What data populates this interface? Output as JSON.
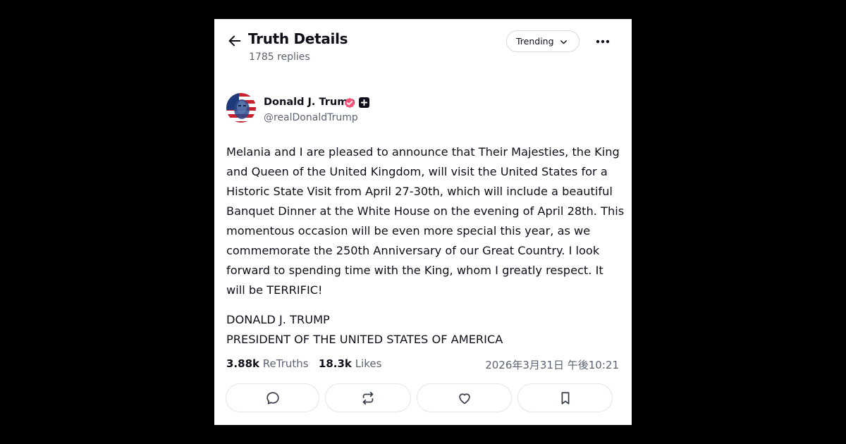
{
  "header": {
    "title": "Truth Details",
    "replies": "1785 replies",
    "sort_label": "Trending",
    "icons": {
      "back": "arrow-left-icon",
      "sort": "chevron-down-icon",
      "more": "more-horizontal-icon"
    }
  },
  "author": {
    "name": "Donald J. Trump",
    "handle": "@realDonaldTrump",
    "badges": [
      "verified-check-icon",
      "plus-badge-icon"
    ],
    "verified_color": "#f6557b"
  },
  "post": {
    "text": "Melania and I are pleased to announce that Their Majesties, the King and Queen of the United Kingdom, will visit the United States for a Historic State Visit from April 27-30th, which will include a beautiful Banquet Dinner at the White House on the evening of April 28th. This momentous occasion will be even more special this year, as we commemorate the 250th Anniversary of our Great Country. I look forward to spending time with the King, whom I greatly respect. It will be TERRIFIC!",
    "signature_line1": "DONALD J. TRUMP",
    "signature_line2": "PRESIDENT OF THE UNITED STATES OF AMERICA"
  },
  "stats": {
    "retruths_count": "3.88k",
    "retruths_label": "ReTruths",
    "likes_count": "18.3k",
    "likes_label": "Likes",
    "timestamp": "2026年3月31日 午後10:21"
  },
  "actions": [
    {
      "name": "reply",
      "icon": "reply-bubble-icon"
    },
    {
      "name": "retruth",
      "icon": "repost-icon"
    },
    {
      "name": "like",
      "icon": "heart-icon"
    },
    {
      "name": "bookmark",
      "icon": "bookmark-icon"
    }
  ]
}
